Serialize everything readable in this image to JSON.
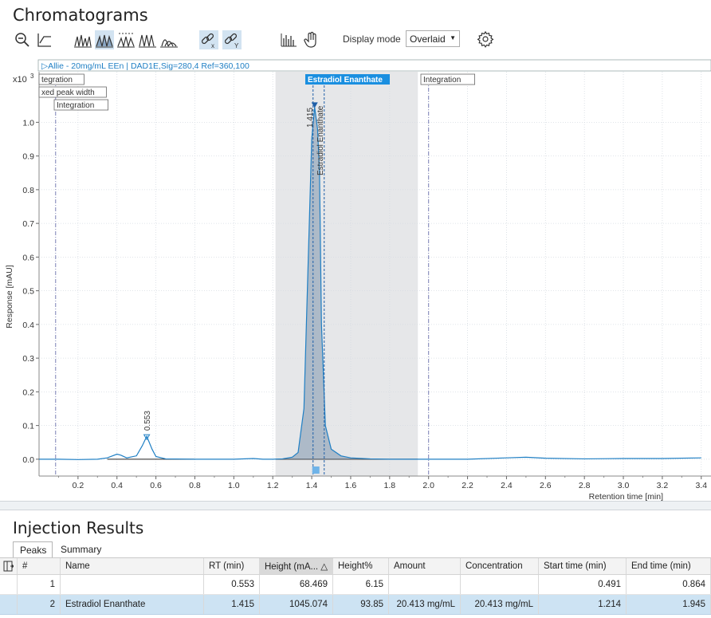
{
  "title": "Chromatograms",
  "toolbar": {
    "display_mode_label": "Display mode",
    "display_mode_value": "Overlaid"
  },
  "chart": {
    "trace_label": "▷Allie - 20mg/mL EEn | DAD1E,Sig=280,4 Ref=360,100",
    "multiplier": "x10",
    "multiplier_exp": "3",
    "ylabel": "Response [mAU]",
    "xlabel": "Retention time [min]",
    "event_labels": [
      "tegration",
      "xed peak width",
      "Integration",
      "Integration"
    ],
    "peak_name_tag": "Estradiol Enanthate",
    "peak_rt_label_1": "1.415",
    "peak_name_vertical": "Estradiol Enanthate",
    "peak_rt_label_2": "0.553"
  },
  "chart_data": {
    "type": "line",
    "title": "",
    "xlabel": "Retention time [min]",
    "ylabel": "Response [mAU]",
    "xlim": [
      0.0,
      3.45
    ],
    "ylim": [
      -0.05,
      1.15
    ],
    "x_ticks": [
      "0.2",
      "0.4",
      "0.6",
      "0.8",
      "1.0",
      "1.2",
      "1.4",
      "1.6",
      "1.8",
      "2.0",
      "2.2",
      "2.4",
      "2.6",
      "2.8",
      "3.0",
      "3.2",
      "3.4"
    ],
    "y_ticks": [
      "0.0",
      "0.1",
      "0.2",
      "0.3",
      "0.4",
      "0.5",
      "0.6",
      "0.7",
      "0.8",
      "0.9",
      "1.0"
    ],
    "series": [
      {
        "color": "#1f7fc4",
        "x": [
          0.0,
          0.1,
          0.2,
          0.3,
          0.35,
          0.4,
          0.42,
          0.45,
          0.5,
          0.53,
          0.553,
          0.58,
          0.6,
          0.65,
          0.8,
          1.0,
          1.1,
          1.15,
          1.2,
          1.25,
          1.3,
          1.33,
          1.36,
          1.38,
          1.4,
          1.415,
          1.43,
          1.44,
          1.45,
          1.47,
          1.5,
          1.55,
          1.6,
          1.7,
          1.8,
          1.9,
          2.0,
          2.2,
          2.4,
          2.5,
          2.6,
          2.8,
          3.0,
          3.2,
          3.4
        ],
        "y": [
          0.0,
          0.0,
          -0.001,
          0.0,
          0.004,
          0.015,
          0.012,
          0.004,
          0.01,
          0.04,
          0.068,
          0.03,
          0.008,
          0.001,
          0.0,
          0.0,
          0.002,
          0.0,
          0.0,
          0.001,
          0.006,
          0.02,
          0.15,
          0.55,
          0.95,
          1.045,
          0.98,
          0.85,
          0.4,
          0.1,
          0.03,
          0.01,
          0.004,
          0.001,
          0.0,
          0.0,
          0.0,
          0.0,
          0.004,
          0.006,
          0.003,
          0.001,
          0.002,
          0.002,
          0.004
        ]
      }
    ],
    "integration_window": [
      1.214,
      1.945
    ],
    "peaks": [
      {
        "rt": 0.553,
        "height": 0.068
      },
      {
        "rt": 1.415,
        "height": 1.045,
        "name": "Estradiol Enanthate"
      }
    ]
  },
  "results": {
    "title": "Injection Results",
    "tabs": [
      "Peaks",
      "Summary"
    ],
    "columns": [
      "#",
      "Name",
      "RT (min)",
      "Height (mA... △",
      "Height%",
      "Amount",
      "Concentration",
      "Start time (min)",
      "End time (min)"
    ],
    "rows": [
      [
        "1",
        "",
        "0.553",
        "68.469",
        "6.15",
        "",
        "",
        "0.491",
        "0.864"
      ],
      [
        "2",
        "Estradiol Enanthate",
        "1.415",
        "1045.074",
        "93.85",
        "20.413 mg/mL",
        "20.413 mg/mL",
        "1.214",
        "1.945"
      ]
    ]
  }
}
